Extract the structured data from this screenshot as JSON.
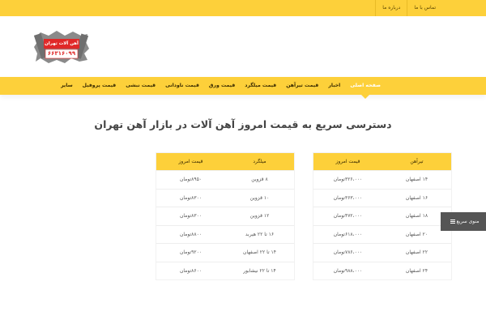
{
  "topbar": {
    "links": [
      {
        "label": "تماس با ما"
      },
      {
        "label": "درباره ما"
      }
    ]
  },
  "logo": {
    "text": "آهن آلات تهران",
    "phone": "۶۶۳۱۶۰۹۹",
    "colors": {
      "accent": "#e02828",
      "gear": "#8a8a8a"
    }
  },
  "nav": {
    "items": [
      {
        "label": "صفحه اصلی",
        "active": true
      },
      {
        "label": "اخبار"
      },
      {
        "label": "قیمت تیرآهن"
      },
      {
        "label": "قیمت میلگرد"
      },
      {
        "label": "قیمت ورق"
      },
      {
        "label": "قیمت ناودانی"
      },
      {
        "label": "قیمت نبشی"
      },
      {
        "label": "قیمت پروفیل"
      },
      {
        "label": "سایر"
      }
    ]
  },
  "main": {
    "title": "دسترسی سریع به قیمت امروز آهن آلات در بازار آهن تهران"
  },
  "table_beams": {
    "headers": [
      "تیرآهن",
      "قیمت امروز"
    ],
    "rows": [
      [
        "۱۴ اصفهان",
        "۳۲۶،۰۰۰تومان"
      ],
      [
        "۱۶ اصفهان",
        "۳۶۳،۰۰۰تومان"
      ],
      [
        "۱۸ اصفهان",
        "۴۷۲،۰۰۰تومان"
      ],
      [
        "۲۰ اصفهان",
        "۶۱۸،۰۰۰تومان"
      ],
      [
        "۲۲ اصفهان",
        "۷۸۶،۰۰۰تومان"
      ],
      [
        "۲۴ اصفهان",
        "۹۸۸،۰۰۰تومان"
      ]
    ]
  },
  "table_rebar": {
    "headers": [
      "میلگرد",
      "قیمت امروز"
    ],
    "rows": [
      [
        "۸ قزوین",
        "۸۹۵۰تومان"
      ],
      [
        "۱۰ قزوین",
        "۸۳۰۰تومان"
      ],
      [
        "۱۲ قزوین",
        "۸۳۰۰تومان"
      ],
      [
        "۱۶ تا ۲۲ هیربد",
        "۸۸۰۰تومان"
      ],
      [
        "۱۴ تا ۲۲ اصفهان",
        "۹۲۰۰تومان"
      ],
      [
        "۱۴ تا ۲۲ نیشابور",
        "۸۶۰۰تومان"
      ]
    ]
  },
  "quick_menu": {
    "label": "منوی سریع",
    "icon": "hamburger-icon"
  },
  "colors": {
    "primary": "#fdd03a",
    "menu_bg": "#555555"
  }
}
